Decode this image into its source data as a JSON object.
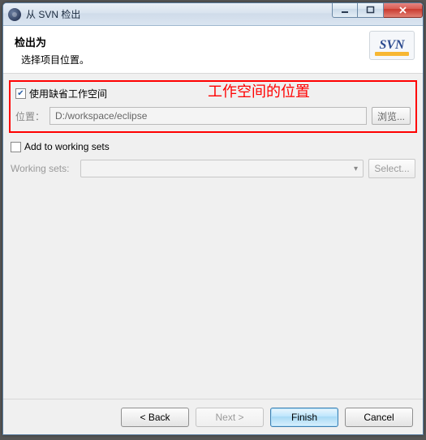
{
  "window": {
    "title": "从 SVN 检出"
  },
  "header": {
    "title": "检出为",
    "subtitle": "选择项目位置。",
    "logo_text": "SVN"
  },
  "workspace": {
    "use_default_label": "使用缺省工作空间",
    "use_default_checked": true,
    "location_label": "位置：",
    "location_value": "D:/workspace/eclipse",
    "browse_label": "浏览..."
  },
  "annotation": {
    "text": "工作空间的位置"
  },
  "working_sets": {
    "add_label": "Add to working sets",
    "add_checked": false,
    "label": "Working sets:",
    "value": "",
    "select_label": "Select..."
  },
  "footer": {
    "back": "< Back",
    "next": "Next >",
    "finish": "Finish",
    "cancel": "Cancel"
  }
}
